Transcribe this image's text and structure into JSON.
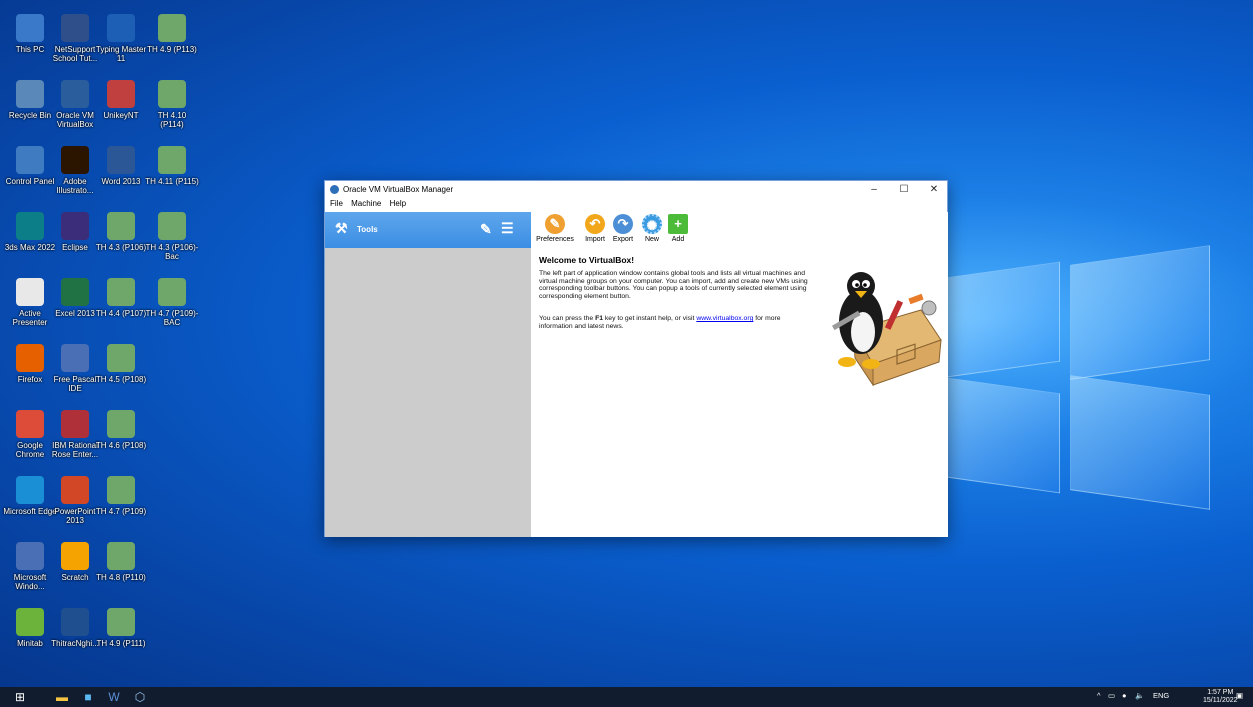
{
  "desktop": {
    "icons": [
      {
        "label": "This PC",
        "icon": "computer-icon",
        "color": "#3a78c9"
      },
      {
        "label": "NetSupport School Tut...",
        "icon": "netsupport-icon",
        "color": "#2e4f8a"
      },
      {
        "label": "Typing Master 11",
        "icon": "typing-master-icon",
        "color": "#1d5fb5"
      },
      {
        "label": "TH 4.9 (P113)",
        "icon": "excel-file-icon",
        "color": "#6fa76b"
      },
      {
        "label": "Recycle Bin",
        "icon": "recycle-bin-icon",
        "color": "#5a88b8"
      },
      {
        "label": "Oracle VM VirtualBox",
        "icon": "virtualbox-icon",
        "color": "#2a5d9b"
      },
      {
        "label": "UnikeyNT",
        "icon": "unikey-icon",
        "color": "#c04040"
      },
      {
        "label": "TH 4.10 (P114)",
        "icon": "excel-file-icon",
        "color": "#6fa76b"
      },
      {
        "label": "Control Panel",
        "icon": "control-panel-icon",
        "color": "#3f7bc0"
      },
      {
        "label": "Adobe Illustrato...",
        "icon": "illustrator-icon",
        "color": "#2b1500"
      },
      {
        "label": "Word 2013",
        "icon": "word-icon",
        "color": "#2b5797"
      },
      {
        "label": "TH 4.11 (P115)",
        "icon": "excel-file-icon",
        "color": "#6fa76b"
      },
      {
        "label": "3ds Max 2022",
        "icon": "3dsmax-icon",
        "color": "#0c7e88"
      },
      {
        "label": "Eclipse",
        "icon": "eclipse-icon",
        "color": "#3b2d7a"
      },
      {
        "label": "TH 4.3 (P106)",
        "icon": "excel-file-icon",
        "color": "#6fa76b"
      },
      {
        "label": "TH 4.3 (P106)-Bac",
        "icon": "excel-file-icon",
        "color": "#6fa76b"
      },
      {
        "label": "Active Presenter",
        "icon": "active-presenter-icon",
        "color": "#e8e8e8"
      },
      {
        "label": "Excel 2013",
        "icon": "excel-icon",
        "color": "#207245"
      },
      {
        "label": "TH 4.4 (P107)",
        "icon": "excel-file-icon",
        "color": "#6fa76b"
      },
      {
        "label": "TH 4.7 (P109)-BAC",
        "icon": "excel-file-icon",
        "color": "#6fa76b"
      },
      {
        "label": "Firefox",
        "icon": "firefox-icon",
        "color": "#e66000"
      },
      {
        "label": "Free Pascal IDE",
        "icon": "free-pascal-icon",
        "color": "#4a6fb5"
      },
      {
        "label": "TH 4.5 (P108)",
        "icon": "excel-file-icon",
        "color": "#6fa76b"
      },
      {
        "label": "Google Chrome",
        "icon": "chrome-icon",
        "color": "#dd4b39"
      },
      {
        "label": "IBM Rational Rose Enter...",
        "icon": "rational-rose-icon",
        "color": "#b0303a"
      },
      {
        "label": "TH 4.6 (P108)",
        "icon": "excel-file-icon",
        "color": "#6fa76b"
      },
      {
        "label": "Microsoft Edge",
        "icon": "edge-icon",
        "color": "#1b8fd6"
      },
      {
        "label": "PowerPoint 2013",
        "icon": "powerpoint-icon",
        "color": "#d24726"
      },
      {
        "label": "TH 4.7 (P109)",
        "icon": "excel-file-icon",
        "color": "#6fa76b"
      },
      {
        "label": "Microsoft Windo...",
        "icon": "math-icon",
        "color": "#4a6fb5"
      },
      {
        "label": "Scratch",
        "icon": "scratch-icon",
        "color": "#f4a300"
      },
      {
        "label": "TH 4.8 (P110)",
        "icon": "excel-file-icon",
        "color": "#6fa76b"
      },
      {
        "label": "Minitab",
        "icon": "minitab-icon",
        "color": "#6bb33a"
      },
      {
        "label": "ThitracNghi...",
        "icon": "quiz-app-icon",
        "color": "#1f4f8f"
      },
      {
        "label": "TH 4.9 (P111)",
        "icon": "excel-file-icon",
        "color": "#6fa76b"
      }
    ]
  },
  "window": {
    "title": "Oracle VM VirtualBox Manager",
    "minimize": "–",
    "maximize": "☐",
    "close": "✕",
    "menu": [
      "File",
      "Machine",
      "Help"
    ],
    "tools_label": "Tools",
    "toolbar": [
      {
        "label": "Preferences",
        "icon": "preferences-icon",
        "color": "#f0a030"
      },
      {
        "label": "Import",
        "icon": "import-icon",
        "color": "#f2a71b"
      },
      {
        "label": "Export",
        "icon": "export-icon",
        "color": "#4d8fd6"
      },
      {
        "label": "New",
        "icon": "new-icon",
        "color": "#3b9be0"
      },
      {
        "label": "Add",
        "icon": "add-icon",
        "color": "#4cbb3a"
      }
    ],
    "welcome_title": "Welcome to VirtualBox!",
    "welcome_text": "The left part of application window contains global tools and lists all virtual machines and virtual machine groups on your computer. You can import, add and create new VMs using corresponding toolbar buttons. You can popup a tools of currently selected element using corresponding element button.",
    "help_pre": "You can press the ",
    "help_key": "F1",
    "help_mid": " key to get instant help, or visit ",
    "help_link": "www.virtualbox.org",
    "help_post": " for more information and latest news."
  },
  "taskbar": {
    "lang": "ENG",
    "time": "1:57 PM",
    "date": "15/11/2022",
    "notification_count": "2"
  }
}
